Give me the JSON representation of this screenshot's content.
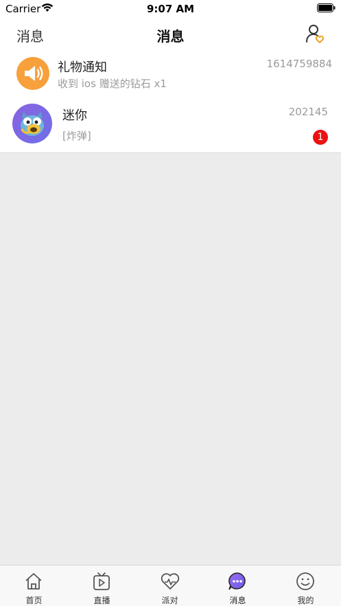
{
  "status_bar": {
    "carrier": "Carrier",
    "time": "9:07 AM"
  },
  "nav": {
    "left_label": "消息",
    "title": "消息",
    "right_icon": "user-heart-icon"
  },
  "messages": [
    {
      "title": "礼物通知",
      "subtitle": "收到 ios 赠送的钻石 x1",
      "time": "1614759884",
      "avatar_icon": "megaphone-icon",
      "avatar_color": "#f7a03c"
    },
    {
      "title": "迷你",
      "subtitle": "[炸弹]",
      "time": "202145",
      "badge": "1",
      "avatar_icon": "owl-avatar",
      "avatar_color": "#7b68e6"
    }
  ],
  "tabs": [
    {
      "label": "首页",
      "icon": "home-icon"
    },
    {
      "label": "直播",
      "icon": "tv-play-icon"
    },
    {
      "label": "派对",
      "icon": "heart-pulse-icon"
    },
    {
      "label": "消息",
      "icon": "chat-bubble-icon",
      "active": true
    },
    {
      "label": "我的",
      "icon": "smiley-icon"
    }
  ],
  "colors": {
    "accent": "#7b5ce6",
    "badge": "#ee1111",
    "gift": "#f7a03c"
  }
}
